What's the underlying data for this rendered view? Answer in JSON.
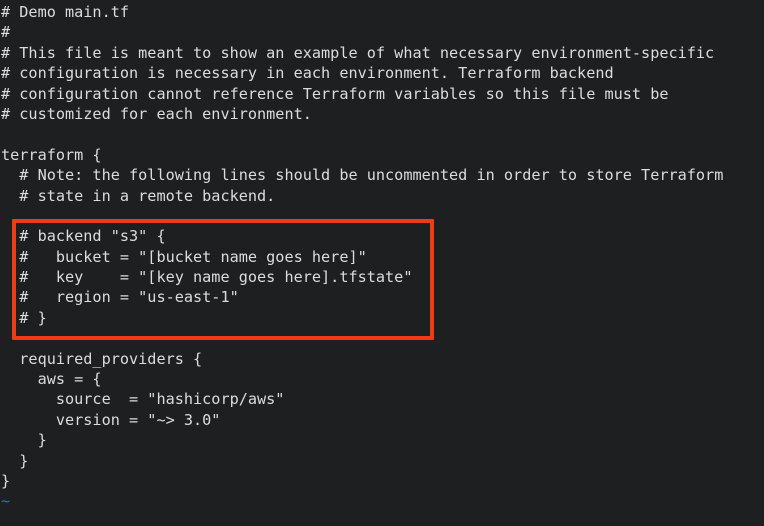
{
  "editor": {
    "name": "vim-terminal-editor",
    "background_color": "#1d1f21",
    "text_color": "#dcdcdc",
    "tilde_color": "#2f6fb5",
    "highlight_color": "#ef3c12"
  },
  "document": {
    "filename": "main.tf",
    "lines": [
      "# Demo main.tf",
      "#",
      "# This file is meant to show an example of what necessary environment-specific",
      "# configuration is necessary in each environment. Terraform backend",
      "# configuration cannot reference Terraform variables so this file must be",
      "# customized for each environment.",
      "",
      "terraform {",
      "  # Note: the following lines should be uncommented in order to store Terraform",
      "  # state in a remote backend.",
      "",
      "  # backend \"s3\" {",
      "  #   bucket = \"[bucket name goes here]\"",
      "  #   key    = \"[key name goes here].tfstate\"",
      "  #   region = \"us-east-1\"",
      "  # }",
      "",
      "  required_providers {",
      "    aws = {",
      "      source  = \"hashicorp/aws\"",
      "      version = \"~> 3.0\"",
      "    }",
      "  }",
      "}",
      ""
    ]
  },
  "empty_buffer_marker": "~",
  "annotation": {
    "label": "backend-block-highlight",
    "shape": "rectangle",
    "color": "#ef3c12",
    "covers_lines": [
      "# backend \"s3\" {",
      "#   bucket = \"[bucket name goes here]\"",
      "#   key    = \"[key name goes here].tfstate\"",
      "#   region = \"us-east-1\"",
      "# }"
    ]
  }
}
